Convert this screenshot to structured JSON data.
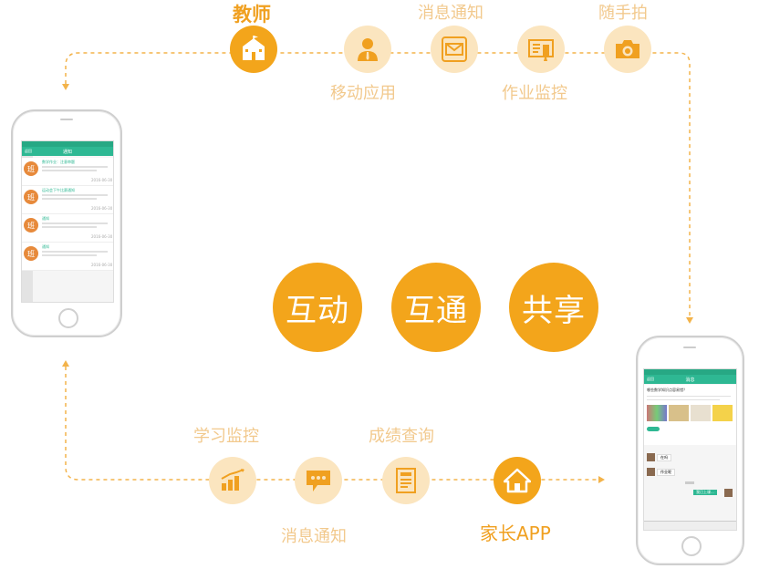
{
  "teacher": {
    "title": "教师",
    "features": [
      {
        "label": "移动应用",
        "icon": "person-icon"
      },
      {
        "label": "消息通知",
        "icon": "mail-icon"
      },
      {
        "label": "作业监控",
        "icon": "homework-icon"
      },
      {
        "label": "随手拍",
        "icon": "camera-icon"
      }
    ]
  },
  "center": {
    "words": [
      "互动",
      "互通",
      "共享"
    ]
  },
  "parent": {
    "title": "家长APP",
    "features": [
      {
        "label": "学习监控",
        "icon": "bar-chart-icon"
      },
      {
        "label": "消息通知",
        "icon": "chat-bubble-icon"
      },
      {
        "label": "成绩查询",
        "icon": "report-icon"
      }
    ]
  },
  "left_phone": {
    "header": "通知",
    "back": "返回",
    "badge": "班",
    "items": [
      {
        "title": "数学作业：注意审题",
        "time": "2016-06-30"
      },
      {
        "title": "运动会下午比赛通知",
        "time": "2016-06-30"
      },
      {
        "title": "通知",
        "time": "2016-06-30"
      },
      {
        "title": "通知",
        "time": "2016-06-30"
      }
    ]
  },
  "right_phone": {
    "header": "消息",
    "back": "返回",
    "question": "哪些数学知识点容易错？",
    "chat": [
      {
        "side": "left",
        "text": "在吗"
      },
      {
        "side": "left",
        "text": "作业呢"
      },
      {
        "side": "right",
        "text": "我已上课..."
      }
    ]
  },
  "colors": {
    "accent": "#f3a51b",
    "light": "#fbe5bf",
    "green": "#2eb893"
  }
}
